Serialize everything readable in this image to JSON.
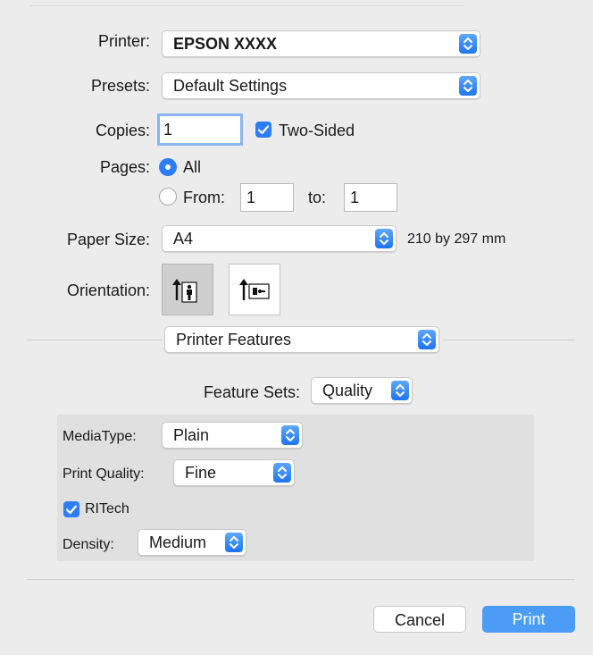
{
  "printer": {
    "label": "Printer:",
    "value": "EPSON XXXX"
  },
  "presets": {
    "label": "Presets:",
    "value": "Default Settings"
  },
  "copies": {
    "label": "Copies:",
    "value": "1",
    "two_sided_label": "Two-Sided",
    "two_sided_checked": true
  },
  "pages": {
    "label": "Pages:",
    "all_label": "All",
    "from_label": "From:",
    "from_value": "1",
    "to_label": "to:",
    "to_value": "1",
    "selected": "All"
  },
  "paper_size": {
    "label": "Paper Size:",
    "value": "A4",
    "dimensions": "210 by 297 mm"
  },
  "orientation": {
    "label": "Orientation:",
    "options": [
      "portrait-icon",
      "landscape-icon"
    ],
    "selected": "portrait"
  },
  "section": {
    "value": "Printer Features"
  },
  "feature_sets": {
    "label": "Feature Sets:",
    "value": "Quality"
  },
  "media_type": {
    "label": "MediaType:",
    "value": "Plain"
  },
  "print_quality": {
    "label": "Print Quality:",
    "value": "Fine"
  },
  "ritech": {
    "label": "RITech",
    "checked": true
  },
  "density": {
    "label": "Density:",
    "value": "Medium"
  },
  "buttons": {
    "cancel": "Cancel",
    "print": "Print"
  },
  "colors": {
    "accent": "#2d7df6",
    "print_button": "#4b9cf6",
    "panel": "#e0e0e0",
    "background": "#ececec"
  }
}
